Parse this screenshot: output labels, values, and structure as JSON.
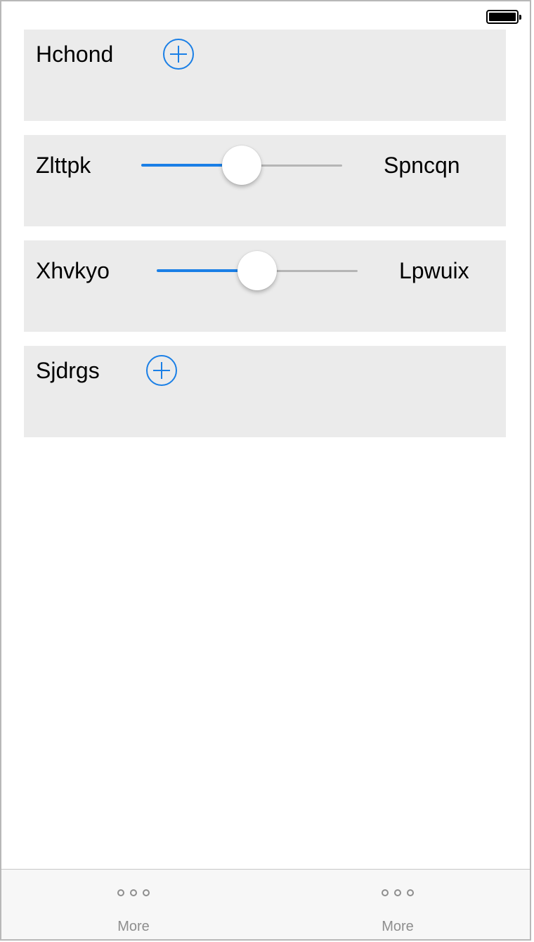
{
  "status_bar": {
    "battery_icon": "battery-full-icon"
  },
  "rows": [
    {
      "type": "stepper",
      "label": "Hchond",
      "button_icon": "plus-circle-icon"
    },
    {
      "type": "slider",
      "label": "Zlttpk",
      "right_label": "Spncqn",
      "value_fraction": 0.5
    },
    {
      "type": "slider",
      "label": "Xhvkyo",
      "right_label": "Lpwuix",
      "value_fraction": 0.5
    },
    {
      "type": "stepper",
      "label": "Sjdrgs",
      "button_icon": "plus-circle-icon"
    }
  ],
  "tab_bar": {
    "items": [
      {
        "label": "More",
        "icon": "more-icon"
      },
      {
        "label": "More",
        "icon": "more-icon"
      }
    ]
  },
  "colors": {
    "accent": "#1a7fe6",
    "card_background": "#ebebeb",
    "track_inactive": "#b5b5b5",
    "tab_inactive": "#8e8e8e"
  }
}
